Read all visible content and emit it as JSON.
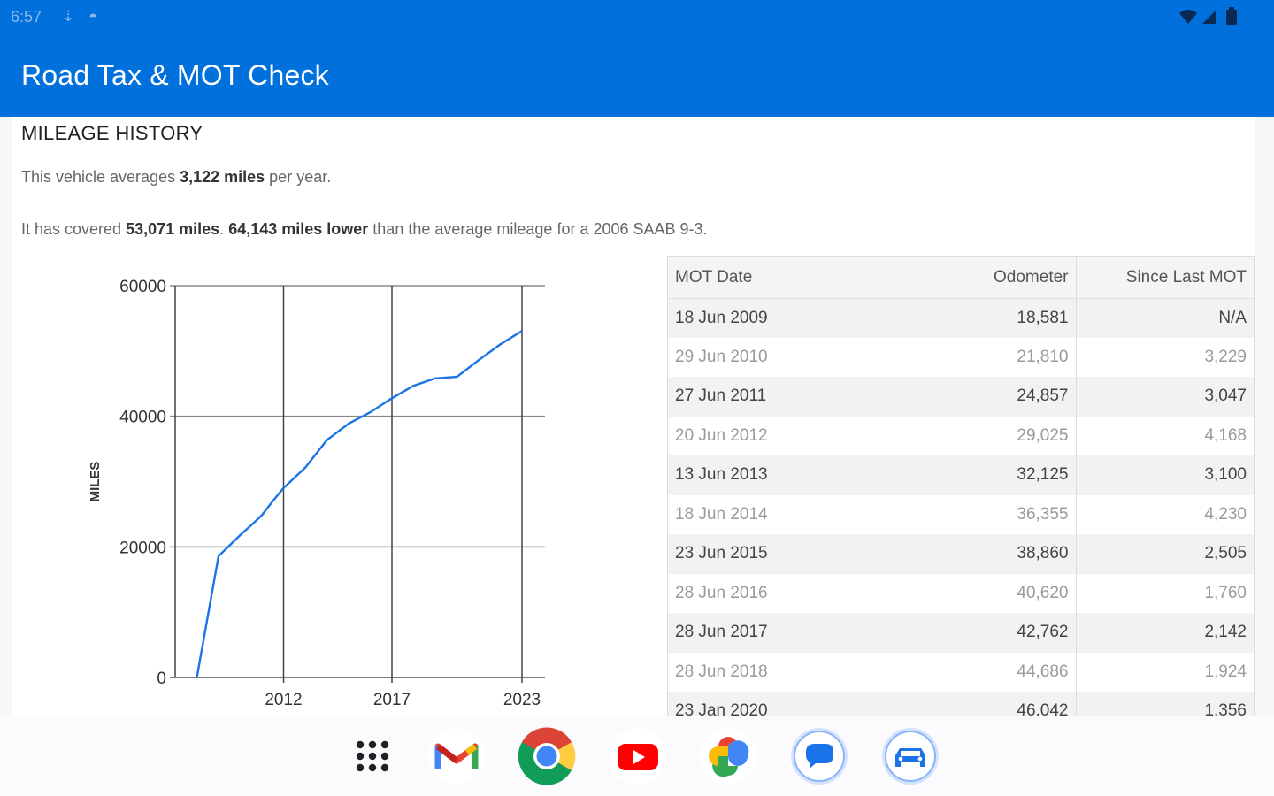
{
  "status_bar": {
    "time": "6:57",
    "icons_left": [
      "usb-icon",
      "sync-icon"
    ],
    "icons_right": [
      "wifi-icon",
      "signal-icon",
      "battery-icon"
    ]
  },
  "app_bar": {
    "title": "Road Tax & MOT Check",
    "color": "#0070dd"
  },
  "mileage": {
    "section_title": "MILEAGE HISTORY",
    "avg_prefix": "This vehicle averages ",
    "avg_value": "3,122 miles",
    "avg_suffix": " per year.",
    "covered_prefix": "It has covered ",
    "covered_value": "53,071 miles",
    "covered_sep": ". ",
    "lower_value": "64,143 miles lower",
    "covered_suffix": " than the average mileage for a 2006 SAAB 9-3."
  },
  "chart_data": {
    "type": "line",
    "title": "",
    "xlabel": "",
    "ylabel": "MILES",
    "ylim": [
      0,
      60000
    ],
    "xlim": [
      2007,
      2023
    ],
    "y_ticks": [
      "0",
      "20000",
      "40000",
      "60000"
    ],
    "x_ticks": [
      "2012",
      "2017",
      "2023"
    ],
    "grid": true,
    "line_color": "#1a73e8",
    "series": [
      {
        "x": [
          2008.0,
          2009.0,
          2009.5,
          2010.0,
          2010.5,
          2011.0,
          2011.5,
          2012.0,
          2013.0,
          2014.0,
          2015.0,
          2016.0,
          2017.0,
          2018.0,
          2019.0,
          2020.0,
          2021.0,
          2022.0,
          2023.0
        ],
        "y": [
          0,
          18581,
          20200,
          21810,
          23300,
          24857,
          27000,
          29025,
          32125,
          36355,
          38860,
          40620,
          42762,
          44686,
          45800,
          46042,
          48600,
          51000,
          53071
        ]
      }
    ]
  },
  "table": {
    "headers": [
      "MOT Date",
      "Odometer",
      "Since Last MOT"
    ],
    "rows": [
      [
        "18 Jun 2009",
        "18,581",
        "N/A"
      ],
      [
        "29 Jun 2010",
        "21,810",
        "3,229"
      ],
      [
        "27 Jun 2011",
        "24,857",
        "3,047"
      ],
      [
        "20 Jun 2012",
        "29,025",
        "4,168"
      ],
      [
        "13 Jun 2013",
        "32,125",
        "3,100"
      ],
      [
        "18 Jun 2014",
        "36,355",
        "4,230"
      ],
      [
        "23 Jun 2015",
        "38,860",
        "2,505"
      ],
      [
        "28 Jun 2016",
        "40,620",
        "1,760"
      ],
      [
        "28 Jun 2017",
        "42,762",
        "2,142"
      ],
      [
        "28 Jun 2018",
        "44,686",
        "1,924"
      ],
      [
        "23 Jan 2020",
        "46,042",
        "1,356"
      ]
    ]
  },
  "dock": {
    "apps": [
      "app-drawer-icon",
      "gmail-icon",
      "chrome-icon",
      "youtube-icon",
      "photos-icon",
      "messages-icon",
      "car-check-app-icon"
    ]
  }
}
